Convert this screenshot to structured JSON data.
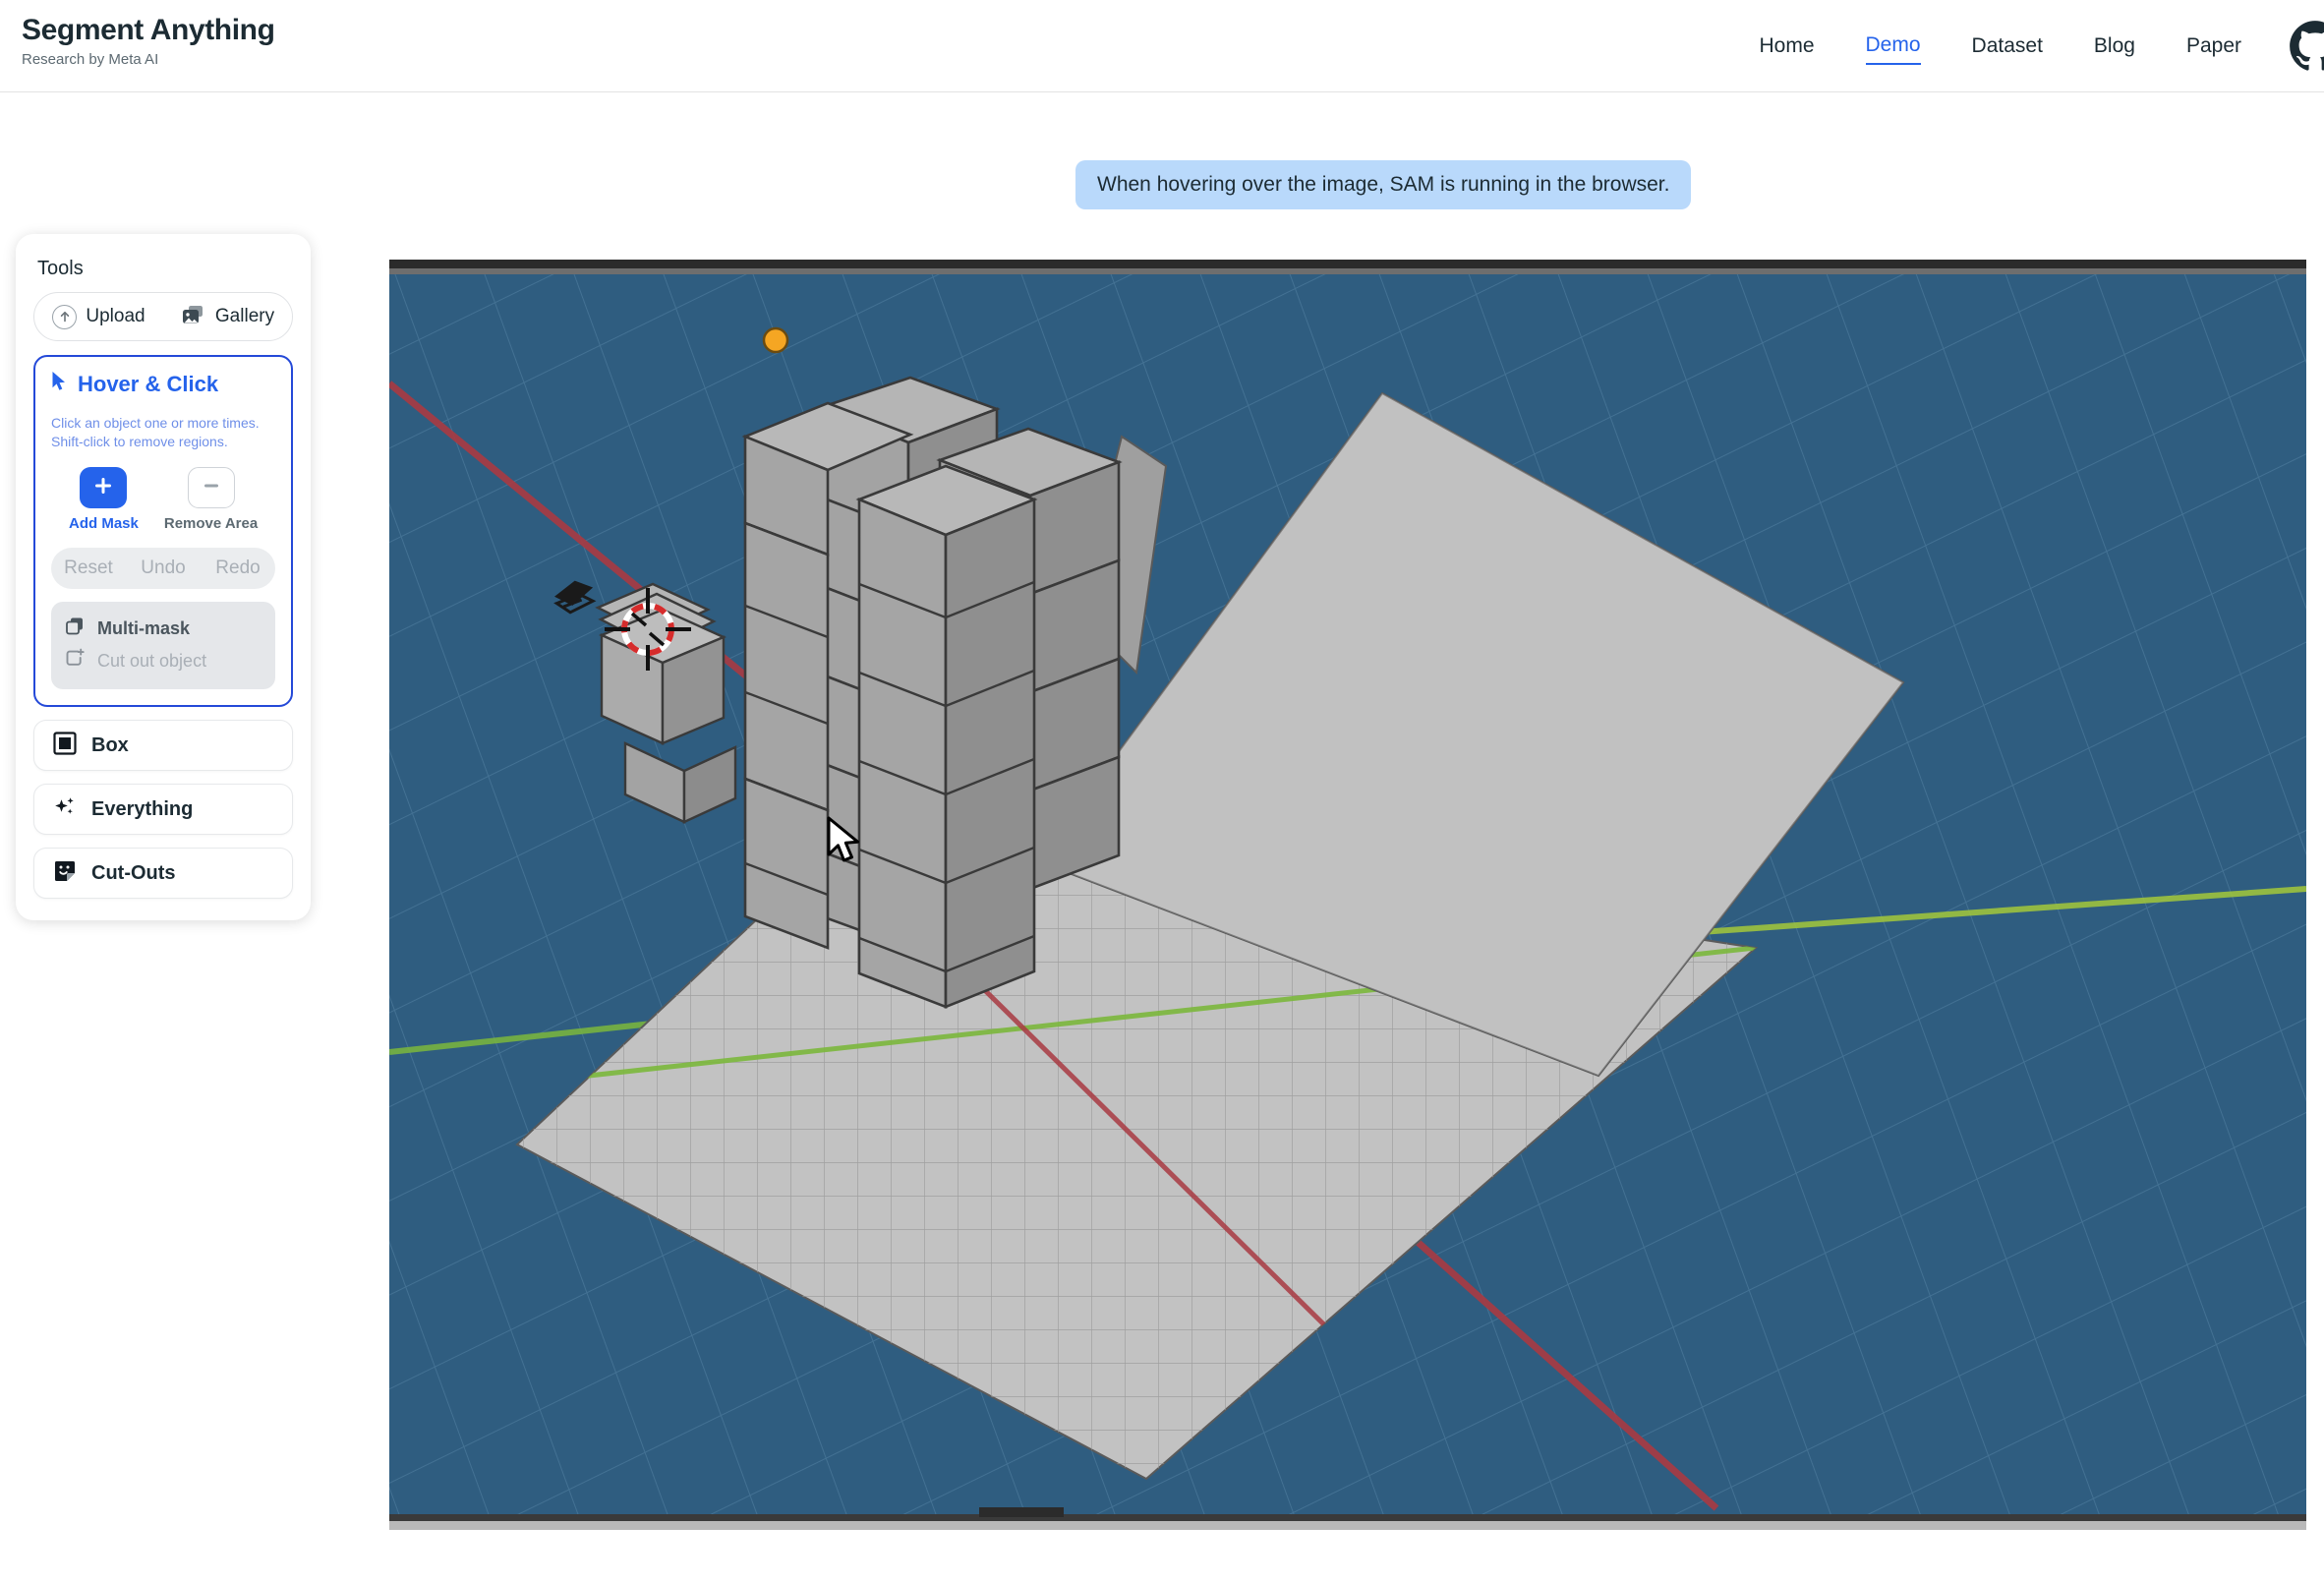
{
  "header": {
    "brand_title": "Segment Anything",
    "brand_subtitle": "Research by Meta AI",
    "nav": [
      {
        "label": "Home",
        "active": false
      },
      {
        "label": "Demo",
        "active": true
      },
      {
        "label": "Dataset",
        "active": false
      },
      {
        "label": "Blog",
        "active": false
      },
      {
        "label": "Paper",
        "active": false
      }
    ],
    "github_icon": "github-icon"
  },
  "hint": {
    "text": "When hovering over the image, SAM is running in the browser.",
    "bg": "#b9d9fb"
  },
  "tools": {
    "title": "Tools",
    "upload": {
      "label": "Upload",
      "icon": "upload-arrow-icon"
    },
    "gallery": {
      "label": "Gallery",
      "icon": "gallery-images-icon"
    },
    "hover_click": {
      "title": "Hover & Click",
      "icon": "cursor-arrow-icon",
      "description_line1": "Click an object one or more times.",
      "description_line2": "Shift-click to remove regions.",
      "add_mask": {
        "label": "Add Mask",
        "icon": "plus-icon",
        "active": true
      },
      "remove_area": {
        "label": "Remove Area",
        "icon": "minus-icon",
        "active": false
      },
      "controls": [
        {
          "label": "Reset",
          "enabled": false
        },
        {
          "label": "Undo",
          "enabled": false
        },
        {
          "label": "Redo",
          "enabled": false
        }
      ],
      "multi_mask": {
        "label": "Multi-mask",
        "icon": "layers-icon",
        "enabled": true
      },
      "cut_out": {
        "label": "Cut out object",
        "icon": "cut-out-icon",
        "enabled": false
      }
    },
    "items": [
      {
        "label": "Box",
        "icon": "box-icon"
      },
      {
        "label": "Everything",
        "icon": "sparkle-icon"
      },
      {
        "label": "Cut-Outs",
        "icon": "sticker-icon"
      }
    ]
  },
  "viewport": {
    "name": "3d-scene-viewport",
    "background_color": "#2f5d80",
    "ground_color": "#c0c0c0",
    "block_color": "#9a9a9a",
    "x_axis_color": "#a93a42",
    "y_axis_color": "#7cb83c",
    "cursor_3d": "blender-3d-cursor",
    "cursor_pointer": "mouse-pointer-cursor",
    "orange_marker_color": "#f5a623",
    "top_bar_color": "#3c3c3c"
  },
  "colors": {
    "accent": "#2563eb",
    "accent_border": "#2449d8",
    "text": "#1c2b33",
    "muted": "#a9afb6"
  }
}
